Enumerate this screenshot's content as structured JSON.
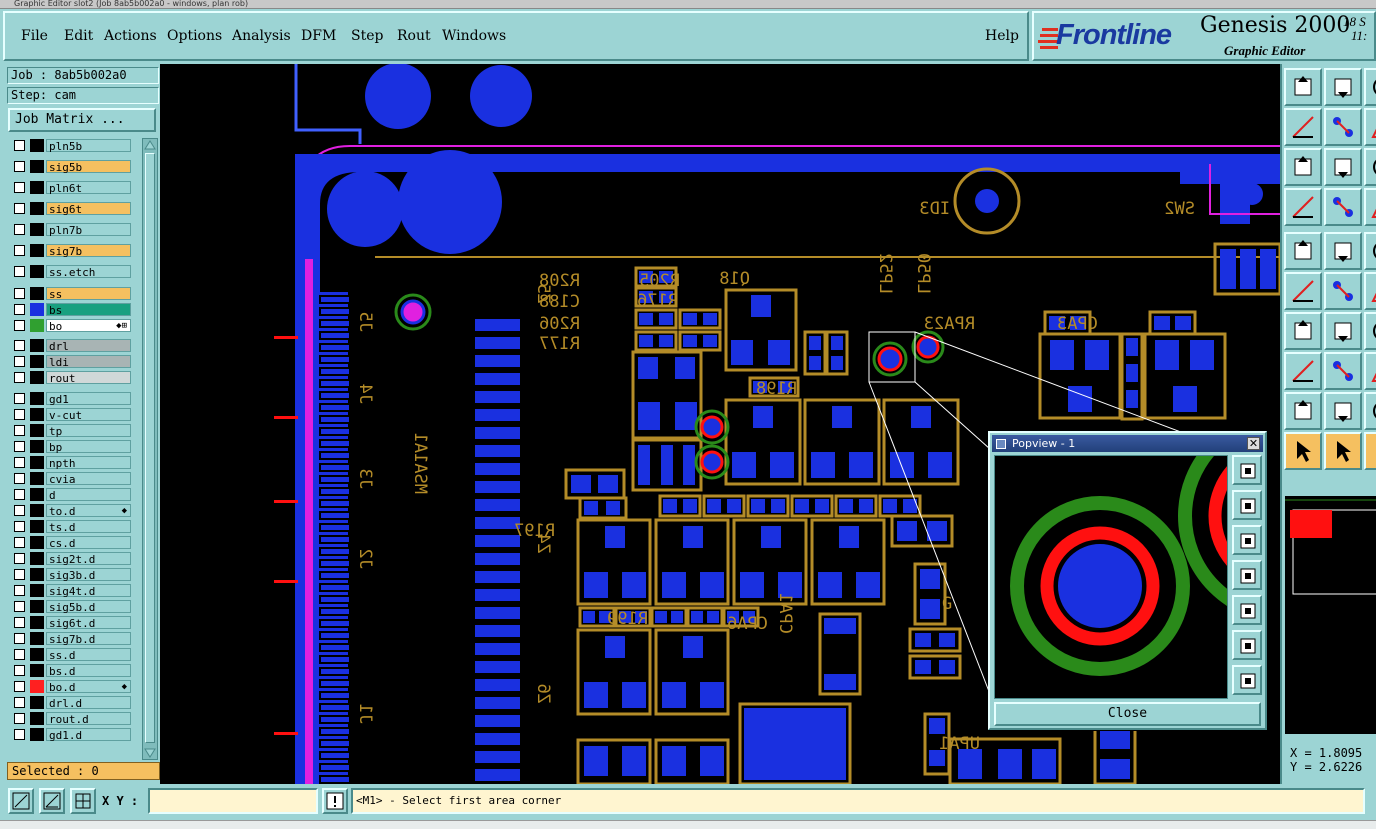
{
  "window": {
    "title": "Graphic Editor slot2 (Job 8ab5b002a0 - windows, plan rob)"
  },
  "menu": {
    "file": "File",
    "edit": "Edit",
    "actions": "Actions",
    "options": "Options",
    "analysis": "Analysis",
    "dfm": "DFM",
    "step": "Step",
    "rout": "Rout",
    "windows": "Windows",
    "help": "Help"
  },
  "brand": {
    "logo": "Frontline",
    "product": "Genesis 2000",
    "subtitle": "Graphic Editor",
    "date_line1": "18 S",
    "date_line2": "11:"
  },
  "job": {
    "job_label": "Job : 8ab5b002a0",
    "step_label": "Step: cam",
    "job_matrix": "Job Matrix ..."
  },
  "layers": [
    {
      "name": "pln5b",
      "bg": "#9cd4d4",
      "color": "#000000"
    },
    {
      "name": "sig5b",
      "bg": "#f5c060",
      "color": "#000000"
    },
    {
      "name": "pln6t",
      "bg": "#9cd4d4",
      "color": "#000000"
    },
    {
      "name": "sig6t",
      "bg": "#f5c060",
      "color": "#000000"
    },
    {
      "name": "pln7b",
      "bg": "#9cd4d4",
      "color": "#000000"
    },
    {
      "name": "sig7b",
      "bg": "#f5c060",
      "color": "#000000"
    },
    {
      "name": "ss.etch",
      "bg": "#9cd4d4",
      "color": "#000000"
    },
    {
      "name": "ss",
      "bg": "#f5c060",
      "color": "#000000"
    },
    {
      "name": "bs",
      "bg": "#18a080",
      "color": "#1a30e0"
    },
    {
      "name": "bo",
      "bg": "#ffffff",
      "color": "#30a030",
      "flag": "◆⊞"
    },
    {
      "name": "drl",
      "bg": "#a8b4b4",
      "color": "#000000"
    },
    {
      "name": "ldi",
      "bg": "#a8b4b4",
      "color": "#000000"
    },
    {
      "name": "rout",
      "bg": "#d0d8d8",
      "color": "#000000"
    },
    {
      "name": "gd1",
      "bg": "#9cd4d4",
      "color": "#000000"
    },
    {
      "name": "v-cut",
      "bg": "#9cd4d4",
      "color": "#000000"
    },
    {
      "name": "tp",
      "bg": "#9cd4d4",
      "color": "#000000"
    },
    {
      "name": "bp",
      "bg": "#9cd4d4",
      "color": "#000000"
    },
    {
      "name": "npth",
      "bg": "#9cd4d4",
      "color": "#000000"
    },
    {
      "name": "cvia",
      "bg": "#9cd4d4",
      "color": "#000000"
    },
    {
      "name": "d",
      "bg": "#9cd4d4",
      "color": "#000000"
    },
    {
      "name": "to.d",
      "bg": "#9cd4d4",
      "color": "#000000",
      "flag": "◆"
    },
    {
      "name": "ts.d",
      "bg": "#9cd4d4",
      "color": "#000000"
    },
    {
      "name": "cs.d",
      "bg": "#9cd4d4",
      "color": "#000000"
    },
    {
      "name": "sig2t.d",
      "bg": "#9cd4d4",
      "color": "#000000"
    },
    {
      "name": "sig3b.d",
      "bg": "#9cd4d4",
      "color": "#000000"
    },
    {
      "name": "sig4t.d",
      "bg": "#9cd4d4",
      "color": "#000000"
    },
    {
      "name": "sig5b.d",
      "bg": "#9cd4d4",
      "color": "#000000"
    },
    {
      "name": "sig6t.d",
      "bg": "#9cd4d4",
      "color": "#000000"
    },
    {
      "name": "sig7b.d",
      "bg": "#9cd4d4",
      "color": "#000000"
    },
    {
      "name": "ss.d",
      "bg": "#9cd4d4",
      "color": "#000000"
    },
    {
      "name": "bs.d",
      "bg": "#9cd4d4",
      "color": "#000000"
    },
    {
      "name": "bo.d",
      "bg": "#9cd4d4",
      "color": "#ff2020",
      "flag": "◆"
    },
    {
      "name": "drl.d",
      "bg": "#9cd4d4",
      "color": "#000000"
    },
    {
      "name": "rout.d",
      "bg": "#9cd4d4",
      "color": "#000000"
    },
    {
      "name": "gd1.d",
      "bg": "#9cd4d4",
      "color": "#000000"
    }
  ],
  "status": {
    "selected": "Selected : 0",
    "xy_label": "X Y :",
    "xy_value": "",
    "prompt": "<M1> - Select first area corner",
    "coord_x": "X = 1.8095",
    "coord_y": "Y = 2.6226"
  },
  "popview": {
    "title": "Popview - 1",
    "close_label": "Close"
  },
  "pcb_labels": {
    "id3": "ID3",
    "sw2": "SW2",
    "r208": "R208",
    "r205": "R205",
    "q18": "Q18",
    "c188": "C188",
    "r176": "R176",
    "r206": "R206",
    "r177": "R177",
    "r198": "R198",
    "rpa23": "RPA23",
    "cpa3": "CPA3",
    "r199": "R199",
    "r197": "R197",
    "cpa6": "CPA6",
    "cpa1": "CPA1",
    "upa1": "UPA1",
    "lp52": "LP52",
    "lp50": "LP50",
    "msa1a1": "MSA1A1",
    "j5": "J5",
    "j4": "J4",
    "j3": "J3",
    "j2": "J2",
    "j1": "J1",
    "z5": "Z5",
    "z4": "Z4",
    "z6": "Z6",
    "g": "G"
  },
  "colors": {
    "copper": "#b48c28",
    "pad": "#1a30e0",
    "via_ring": "#2a8a1a",
    "via_red": "#ff1010",
    "trace_magenta": "#e020e0",
    "highlight": "#f5c060",
    "panel": "#9cd4d4"
  }
}
